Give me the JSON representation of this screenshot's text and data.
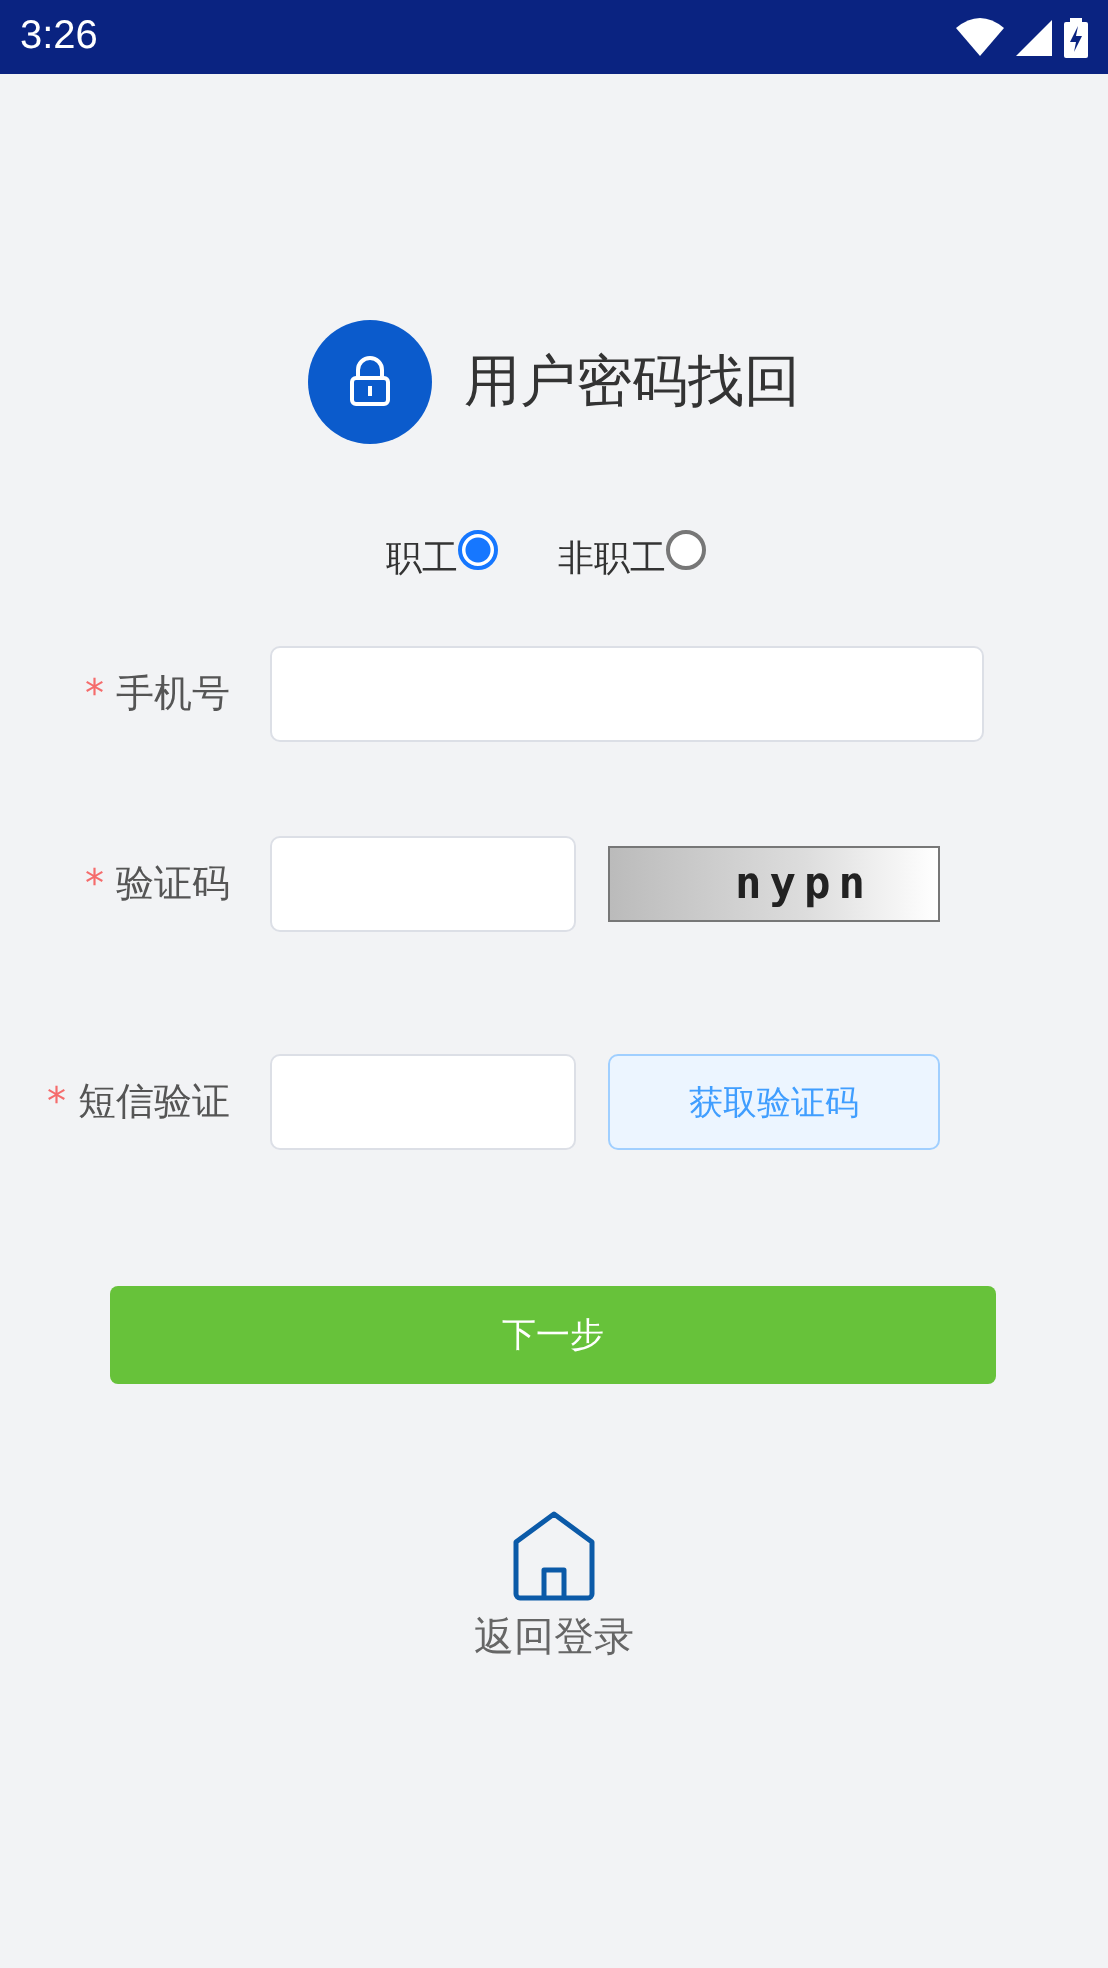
{
  "status_bar": {
    "time": "3:26"
  },
  "header": {
    "title": "用户密码找回"
  },
  "user_types": [
    {
      "label": "职工",
      "selected": true
    },
    {
      "label": "非职工",
      "selected": false
    }
  ],
  "fields": [
    {
      "kind": "text",
      "required_mark": "*",
      "label": "手机号"
    },
    {
      "kind": "captcha",
      "required_mark": "*",
      "label": "验证码",
      "captcha_text": "nypn"
    },
    {
      "kind": "sms",
      "required_mark": "*",
      "label": "短信验证",
      "button": "获取验证码"
    }
  ],
  "next_button": "下一步",
  "back_link": "返回登录"
}
